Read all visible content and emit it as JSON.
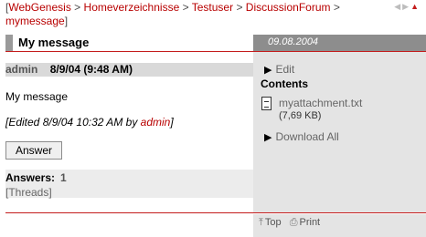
{
  "breadcrumb": {
    "items": [
      "WebGenesis",
      "Homeverzeichnisse",
      "Testuser",
      "DiscussionForum",
      "mymessage"
    ],
    "separator": ">"
  },
  "nav": {
    "prev": "◀",
    "next": "▶",
    "up": "▲"
  },
  "header": {
    "title": "My message",
    "date": "09.08.2004"
  },
  "message": {
    "author": "admin",
    "datetime": "8/9/04 (9:48 AM)",
    "body": "My message",
    "edited_prefix": "[Edited 8/9/04 10:32 AM by ",
    "edited_by": "admin",
    "edited_suffix": "]"
  },
  "actions": {
    "answer_label": "Answer"
  },
  "answers": {
    "label": "Answers:",
    "count": "1",
    "threads_label": "[Threads]"
  },
  "sidebar": {
    "edit_label": "Edit",
    "contents_title": "Contents",
    "attachment_name": "myattachment.txt",
    "attachment_size": "(7,69 KB)",
    "download_label": "Download All"
  },
  "footer": {
    "top_label": "Top",
    "print_label": "Print"
  },
  "colors": {
    "accent_red": "#c41c1c",
    "link_red": "#b80000",
    "sidebar_gray": "#e4e4e4",
    "date_bar_gray": "#8d8d8d"
  }
}
